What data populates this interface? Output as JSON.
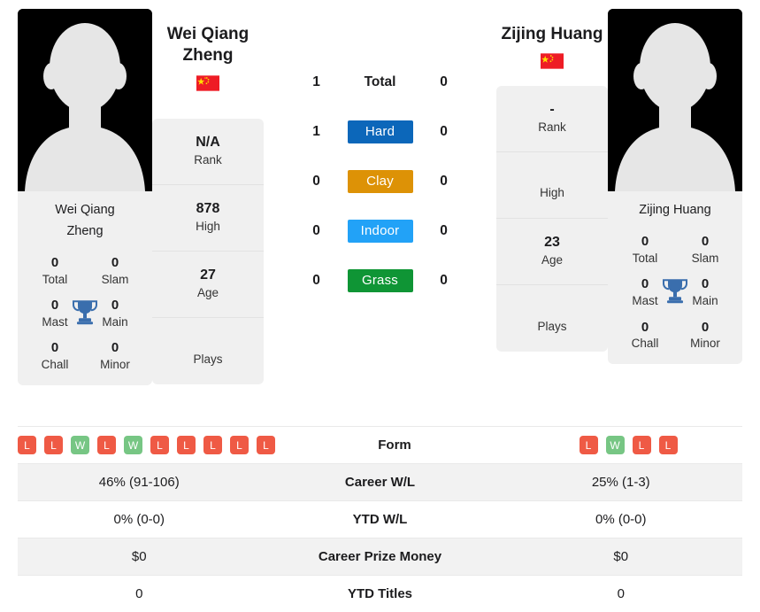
{
  "players": {
    "left": {
      "name_full": "Wei Qiang Zheng",
      "name_line1": "Wei Qiang",
      "name_line2": "Zheng",
      "country": "China",
      "flag_icon": "flag-china-icon",
      "photo_alt": "player-photo-placeholder",
      "rank": "N/A",
      "rank_label": "Rank",
      "high": "878",
      "high_label": "High",
      "age": "27",
      "age_label": "Age",
      "plays": "",
      "plays_label": "Plays",
      "titles": {
        "total": "0",
        "total_label": "Total",
        "slam": "0",
        "slam_label": "Slam",
        "mast": "0",
        "mast_label": "Mast",
        "main": "0",
        "main_label": "Main",
        "chall": "0",
        "chall_label": "Chall",
        "minor": "0",
        "minor_label": "Minor"
      },
      "form": [
        "L",
        "L",
        "W",
        "L",
        "W",
        "L",
        "L",
        "L",
        "L",
        "L"
      ],
      "career_wl": "46% (91-106)",
      "ytd_wl": "0% (0-0)",
      "career_prize_money": "$0",
      "ytd_titles": "0",
      "h2h": {
        "total": "1",
        "hard": "1",
        "clay": "0",
        "indoor": "0",
        "grass": "0"
      }
    },
    "right": {
      "name_full": "Zijing Huang",
      "name_line1": "Zijing Huang",
      "name_line2": "",
      "country": "China",
      "flag_icon": "flag-china-icon",
      "photo_alt": "player-photo-placeholder",
      "rank": "-",
      "rank_label": "Rank",
      "high": "",
      "high_label": "High",
      "age": "23",
      "age_label": "Age",
      "plays": "",
      "plays_label": "Plays",
      "titles": {
        "total": "0",
        "total_label": "Total",
        "slam": "0",
        "slam_label": "Slam",
        "mast": "0",
        "mast_label": "Mast",
        "main": "0",
        "main_label": "Main",
        "chall": "0",
        "chall_label": "Chall",
        "minor": "0",
        "minor_label": "Minor"
      },
      "form": [
        "L",
        "W",
        "L",
        "L"
      ],
      "career_wl": "25% (1-3)",
      "ytd_wl": "0% (0-0)",
      "career_prize_money": "$0",
      "ytd_titles": "0",
      "h2h": {
        "total": "0",
        "hard": "0",
        "clay": "0",
        "indoor": "0",
        "grass": "0"
      }
    }
  },
  "h2h_rows": [
    {
      "key": "total",
      "label": "Total",
      "style": "plain",
      "color": ""
    },
    {
      "key": "hard",
      "label": "Hard",
      "style": "pill",
      "color": "#0c67ba"
    },
    {
      "key": "clay",
      "label": "Clay",
      "style": "pill",
      "color": "#dd9206"
    },
    {
      "key": "indoor",
      "label": "Indoor",
      "style": "pill",
      "color": "#22a2f7"
    },
    {
      "key": "grass",
      "label": "Grass",
      "style": "pill",
      "color": "#0f9535"
    }
  ],
  "stat_rows": [
    {
      "label": "Form"
    },
    {
      "label": "Career W/L"
    },
    {
      "label": "YTD W/L"
    },
    {
      "label": "Career Prize Money"
    },
    {
      "label": "YTD Titles"
    }
  ],
  "colors": {
    "hard": "#0c67ba",
    "clay": "#dd9206",
    "indoor": "#22a2f7",
    "grass": "#0f9535",
    "win_badge": "#77c684",
    "loss_badge": "#ef5a45",
    "panel": "#f0f0f0",
    "row_shade": "#f2f2f2",
    "trophy": "#3a6ead",
    "flag_red": "#ee1c25",
    "flag_yellow": "#ffde00"
  },
  "icons": {
    "trophy": "trophy-icon",
    "flag": "flag-china-icon",
    "avatar": "avatar-silhouette-icon"
  }
}
